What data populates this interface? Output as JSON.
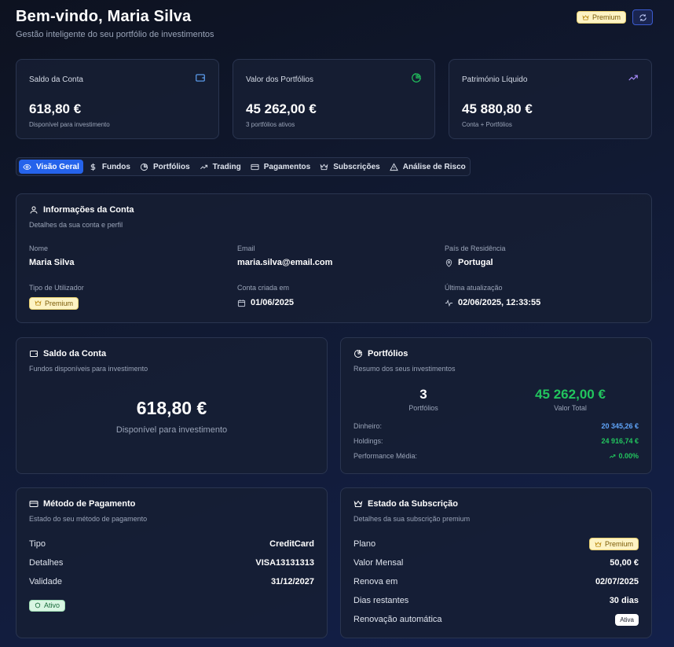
{
  "header": {
    "title": "Bem-vindo, Maria Silva",
    "subtitle": "Gestão inteligente do seu portfólio de investimentos",
    "badge": "Premium"
  },
  "stats": [
    {
      "label": "Saldo da Conta",
      "value": "618,80 €",
      "sub": "Disponível para investimento",
      "icon": "wallet-icon",
      "color": "#60a5fa"
    },
    {
      "label": "Valor dos Portfólios",
      "value": "45 262,00 €",
      "sub": "3 portfólios ativos",
      "icon": "pie-chart-icon",
      "color": "#22c55e"
    },
    {
      "label": "Património Líquido",
      "value": "45 880,80 €",
      "sub": "Conta + Portfólios",
      "icon": "trending-up-icon",
      "color": "#a78bfa"
    }
  ],
  "tabs": [
    {
      "label": "Visão Geral",
      "icon": "eye-icon",
      "active": true
    },
    {
      "label": "Fundos",
      "icon": "dollar-icon"
    },
    {
      "label": "Portfólios",
      "icon": "pie-chart-icon"
    },
    {
      "label": "Trading",
      "icon": "trending-up-icon"
    },
    {
      "label": "Pagamentos",
      "icon": "credit-card-icon"
    },
    {
      "label": "Subscrições",
      "icon": "crown-icon"
    },
    {
      "label": "Análise de Risco",
      "icon": "warning-icon"
    }
  ],
  "account_info": {
    "title": "Informações da Conta",
    "subtitle": "Detalhes da sua conta e perfil",
    "name_label": "Nome",
    "name": "Maria Silva",
    "email_label": "Email",
    "email": "maria.silva@email.com",
    "country_label": "País de Residência",
    "country": "Portugal",
    "user_type_label": "Tipo de Utilizador",
    "user_type": "Premium",
    "created_label": "Conta criada em",
    "created": "01/06/2025",
    "updated_label": "Última atualização",
    "updated": "02/06/2025, 12:33:55"
  },
  "balance": {
    "title": "Saldo da Conta",
    "subtitle": "Fundos disponíveis para investimento",
    "value": "618,80 €",
    "caption": "Disponível para investimento"
  },
  "portfolios": {
    "title": "Portfólios",
    "subtitle": "Resumo dos seus investimentos",
    "count": "3",
    "count_label": "Portfólios",
    "total": "45 262,00 €",
    "total_label": "Valor Total",
    "cash_label": "Dinheiro:",
    "cash": "20 345,26 €",
    "holdings_label": "Holdings:",
    "holdings": "24 916,74 €",
    "performance_label": "Performance Média:",
    "performance": "0.00%"
  },
  "payment": {
    "title": "Método de Pagamento",
    "subtitle": "Estado do seu método de pagamento",
    "type_label": "Tipo",
    "type": "CreditCard",
    "details_label": "Detalhes",
    "details": "VISA13131313",
    "validity_label": "Validade",
    "validity": "31/12/2027",
    "status": "Ativo"
  },
  "subscription": {
    "title": "Estado da Subscrição",
    "subtitle": "Detalhes da sua subscrição premium",
    "plan_label": "Plano",
    "plan": "Premium",
    "monthly_label": "Valor Mensal",
    "monthly": "50,00 €",
    "renews_label": "Renova em",
    "renews": "02/07/2025",
    "days_label": "Dias restantes",
    "days": "30 dias",
    "auto_label": "Renovação automática",
    "auto": "Ativa"
  },
  "colors": {
    "accent": "#2563eb",
    "green": "#22c55e",
    "blue": "#60a5fa",
    "purple": "#a78bfa"
  }
}
